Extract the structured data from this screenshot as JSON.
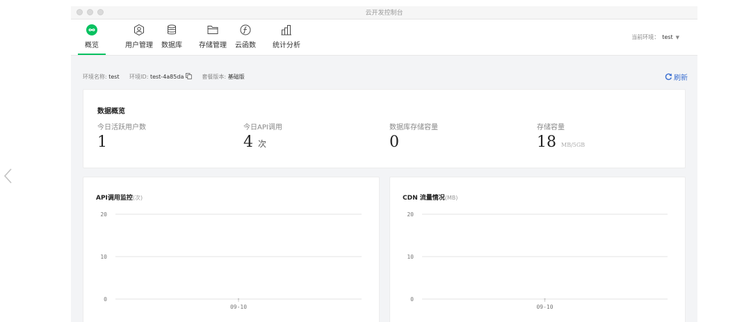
{
  "window": {
    "title": "云开发控制台"
  },
  "nav": {
    "tabs": [
      {
        "label": "概览",
        "icon": "overview-infinity-icon",
        "active": true
      },
      {
        "label": "用户管理",
        "icon": "user-management-icon",
        "active": false
      },
      {
        "label": "数据库",
        "icon": "database-icon",
        "active": false
      },
      {
        "label": "存储管理",
        "icon": "folder-icon",
        "active": false
      },
      {
        "label": "云函数",
        "icon": "cloud-function-icon",
        "active": false
      },
      {
        "label": "统计分析",
        "icon": "statistics-icon",
        "active": false
      }
    ],
    "env_label": "当前环境：",
    "env_value": "test"
  },
  "info": {
    "env_name_label": "环境名称:",
    "env_name": "test",
    "env_id_label": "环境ID:",
    "env_id": "test-4a85da",
    "plan_label": "套餐版本:",
    "plan": "基础版",
    "refresh": "刷新"
  },
  "overview": {
    "title": "数据概览",
    "stats": [
      {
        "label": "今日活跃用户数",
        "value": "1",
        "unit": ""
      },
      {
        "label": "今日API调用",
        "value": "4",
        "unit": "次"
      },
      {
        "label": "数据库存储容量",
        "value": "0",
        "unit": ""
      },
      {
        "label": "存储容量",
        "value": "18",
        "unit": "MB/5GB"
      }
    ]
  },
  "accent": "#07c160",
  "link_color": "#3b6fd1",
  "charts": [
    {
      "title": "API调用监控",
      "unit": "(次)"
    },
    {
      "title": "CDN 流量情况",
      "unit": "(MB)"
    }
  ],
  "chart_data": [
    {
      "type": "line",
      "title": "API调用监控(次)",
      "x": [
        "09-10"
      ],
      "series": [
        {
          "values": [
            0
          ]
        }
      ],
      "ylim": [
        0,
        20
      ],
      "yticks": [
        0,
        10,
        20
      ],
      "grid": true
    },
    {
      "type": "line",
      "title": "CDN 流量情况(MB)",
      "x": [
        "09-10"
      ],
      "series": [
        {
          "values": [
            0
          ]
        }
      ],
      "ylim": [
        0,
        20
      ],
      "yticks": [
        0,
        10,
        20
      ],
      "grid": true
    }
  ]
}
